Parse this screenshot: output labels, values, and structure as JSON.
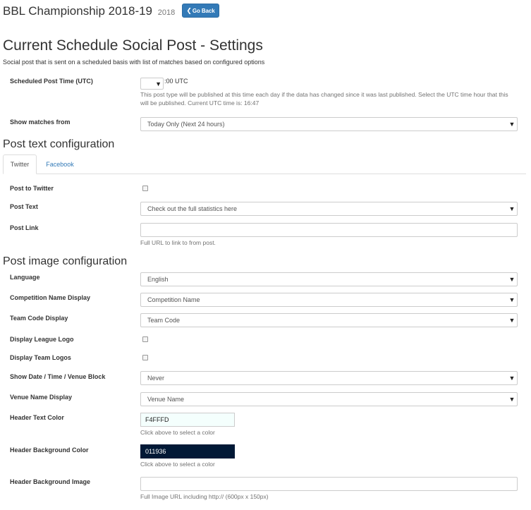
{
  "header": {
    "title": "BBL Championship 2018-19",
    "year": "2018",
    "back_button": "Go Back",
    "back_icon": "chevron-left-icon"
  },
  "page": {
    "title": "Current Schedule Social Post - Settings",
    "description": "Social post that is sent on a scheduled basis with list of matches based on configured options"
  },
  "schedule": {
    "time_label": "Scheduled Post Time (UTC)",
    "hour_value": "",
    "suffix": ":00 UTC",
    "help": "This post type will be published at this time each day if the data has changed since it was last published. Select the UTC time hour that this will be published. Current UTC time is: 16:47",
    "show_matches_label": "Show matches from",
    "show_matches_value": "Today Only (Next 24 hours)"
  },
  "post_text": {
    "heading": "Post text configuration",
    "tabs": [
      {
        "label": "Twitter",
        "active": true
      },
      {
        "label": "Facebook",
        "active": false
      }
    ],
    "post_to_label": "Post to Twitter",
    "post_to_checked": false,
    "post_text_label": "Post Text",
    "post_text_value": "Check out the full statistics here",
    "post_link_label": "Post Link",
    "post_link_value": "",
    "post_link_help": "Full URL to link to from post."
  },
  "post_image": {
    "heading": "Post image configuration",
    "language_label": "Language",
    "language_value": "English",
    "competition_label": "Competition Name Display",
    "competition_value": "Competition Name",
    "team_code_label": "Team Code Display",
    "team_code_value": "Team Code",
    "league_logo_label": "Display League Logo",
    "league_logo_checked": false,
    "team_logos_label": "Display Team Logos",
    "team_logos_checked": false,
    "date_block_label": "Show Date / Time / Venue Block",
    "date_block_value": "Never",
    "venue_label": "Venue Name Display",
    "venue_value": "Venue Name",
    "header_text_color_label": "Header Text Color",
    "header_text_color_value": "F4FFFD",
    "header_text_color_hex": "#F4FFFD",
    "header_text_color_help": "Click above to select a color",
    "header_bg_color_label": "Header Background Color",
    "header_bg_color_value": "011936",
    "header_bg_color_hex": "#011936",
    "header_bg_color_help": "Click above to select a color",
    "header_bg_image_label": "Header Background Image",
    "header_bg_image_value": "",
    "header_bg_image_help": "Full Image URL including http:// (600px x 150px)"
  },
  "colors": {
    "primary": "#337ab7",
    "text": "#333333",
    "help_text": "#737373",
    "border": "#cccccc"
  }
}
